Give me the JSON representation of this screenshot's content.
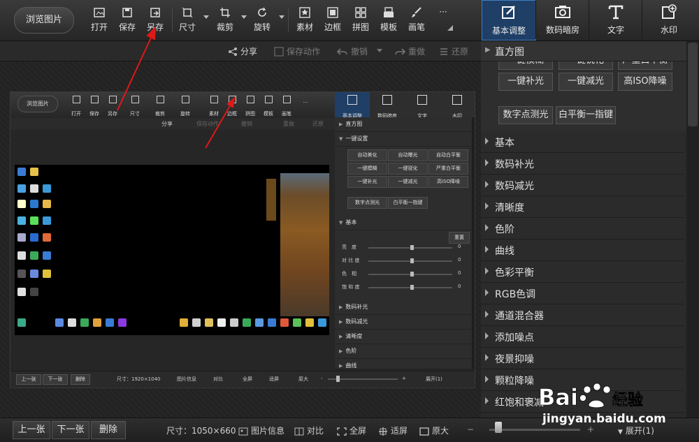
{
  "toolbar": {
    "browse": "浏览图片",
    "tools": [
      {
        "label": "打开",
        "icon": "open-icon"
      },
      {
        "label": "保存",
        "icon": "save-icon"
      },
      {
        "label": "另存",
        "icon": "save-as-icon"
      },
      {
        "label": "尺寸",
        "icon": "resize-icon"
      },
      {
        "label": "裁剪",
        "icon": "crop-icon"
      },
      {
        "label": "旋转",
        "icon": "rotate-icon"
      },
      {
        "label": "素材",
        "icon": "material-icon"
      },
      {
        "label": "边框",
        "icon": "border-icon"
      },
      {
        "label": "拼图",
        "icon": "collage-icon"
      },
      {
        "label": "模板",
        "icon": "template-icon"
      },
      {
        "label": "画笔",
        "icon": "brush-icon"
      },
      {
        "label": "···",
        "icon": "more-icon"
      }
    ]
  },
  "tabs": [
    {
      "label": "基本调整",
      "icon": "basic-adjust-icon",
      "active": true
    },
    {
      "label": "数码暗房",
      "icon": "darkroom-icon",
      "active": false
    },
    {
      "label": "文字",
      "icon": "text-icon",
      "active": false
    },
    {
      "label": "水印",
      "icon": "watermark-icon",
      "active": false
    }
  ],
  "subbar": {
    "share": "分享",
    "batch": "保存动作",
    "undo": "撤销",
    "redo": "重做",
    "restore": "还原"
  },
  "right_panel": {
    "histogram": "直方图",
    "quick_row0": [
      "一键模糊",
      "一键锐化",
      "严重白平衡"
    ],
    "quick_row1": [
      "一键补光",
      "一键减光",
      "高ISO降噪"
    ],
    "quick_row2": [
      "数字点测光",
      "白平衡一指键"
    ],
    "sections": [
      "基本",
      "数码补光",
      "数码减光",
      "清晰度",
      "色阶",
      "曲线",
      "色彩平衡",
      "RGB色调",
      "通道混合器",
      "添加噪点",
      "夜景抑噪",
      "颗粒降噪",
      "红饱和褒减"
    ]
  },
  "bottom": {
    "prev": "上一张",
    "next": "下一张",
    "delete": "删除",
    "size": "尺寸：1050×660",
    "info": "图片信息",
    "compare": "对比",
    "fullscreen": "全屏",
    "fit": "适屏",
    "original": "原大",
    "zoom_plus": "+",
    "expand": "展开(1)",
    "zoom_level": 0.1
  },
  "inner": {
    "browse": "浏览图片",
    "tools": [
      "打开",
      "保存",
      "另存",
      "尺寸",
      "裁剪",
      "旋转",
      "素材",
      "边框",
      "拼图",
      "模板",
      "画笔",
      "···"
    ],
    "tabs": [
      "基本调整",
      "数码暗房",
      "文字",
      "水印"
    ],
    "sub": {
      "share": "分享",
      "batch": "保存动作",
      "undo": "撤销",
      "redo": "重做",
      "restore": "还原"
    },
    "panel": {
      "histogram": "直方图",
      "onekey": "一键设置",
      "buttons": [
        "自动美化",
        "自动曝光",
        "自动白平衡",
        "一键模糊",
        "一键锐化",
        "严重白平衡",
        "一键补光",
        "一键减光",
        "高ISO降噪"
      ],
      "meter": "数字点测光",
      "wb": "白平衡一指键",
      "basic": "基本",
      "reset": "重置",
      "sliders": [
        {
          "label": "亮　度",
          "value": "0"
        },
        {
          "label": "对 比 度",
          "value": "0"
        },
        {
          "label": "色　相",
          "value": "0"
        },
        {
          "label": "饱 和 度",
          "value": "0"
        }
      ],
      "rows": [
        "数码补光",
        "数码减光",
        "清晰度",
        "色阶",
        "曲线"
      ]
    },
    "bottom": {
      "prev": "上一张",
      "next": "下一张",
      "delete": "删除",
      "size": "尺寸：1920×1040",
      "info": "图片信息",
      "compare": "对比",
      "fullscreen": "全屏",
      "fit": "适屏",
      "original": "原大",
      "minus": "-",
      "plus": "+",
      "expand": "展开(1)"
    }
  },
  "watermark": {
    "url": "jingyan.baidu.com"
  }
}
